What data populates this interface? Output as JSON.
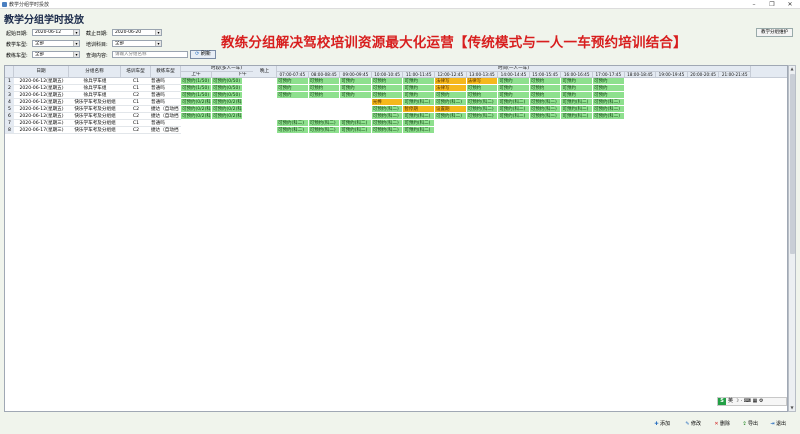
{
  "window": {
    "title": "教学分组学时投放",
    "minimize": "–",
    "restore": "❐",
    "close": "✕"
  },
  "page_title": "教学分组学时投放",
  "headline": "教练分组解决驾校培训资源最大化运营【传统模式与一人一车预约培训结合】",
  "filters": {
    "start_label": "起始日期:",
    "start_value": "2020-06-12",
    "end_label": "截止日期:",
    "end_value": "2020-06-20",
    "car_type_label": "教学车型:",
    "car_type_value": "全部",
    "subject_label": "培训科目:",
    "subject_value": "全部",
    "coach_car_label": "教练车型:",
    "coach_car_value": "全部",
    "query_label": "查询内容:",
    "query_placeholder": "请输入分组名称",
    "query_button": "刷新"
  },
  "maint_button": "教学分组维护",
  "grid": {
    "columns": {
      "date": "日期",
      "group": "分组名称",
      "car": "培训车型",
      "coach": "教练车型"
    },
    "multi_header": "时段(多人一车)",
    "morning": "上午",
    "afternoon": "下午",
    "evening": "晚上",
    "single_header": "时间(一人一车)",
    "slots": [
      "07:00-07:45",
      "08:00-08:45",
      "09:00-09:45",
      "10:00-10:45",
      "11:00-11:45",
      "12:00-12:45",
      "13:00-13:45",
      "14:00-14:45",
      "15:00-15:45",
      "16:00-16:45",
      "17:00-17:45",
      "18:00-18:45",
      "19:00-19:45",
      "20:00-20:45",
      "21:00-21:45"
    ],
    "rows": [
      {
        "n": "1",
        "date": "2020-06-12(星期五)",
        "group": "徐兵学车组",
        "car": "C1",
        "coach": "普通吗",
        "am": "可预约(1/50)",
        "pm": "可预约(0/50)"
      },
      {
        "n": "2",
        "date": "2020-06-12(星期五)",
        "group": "徐兵学车组",
        "car": "C1",
        "coach": "普通吗",
        "am": "可预约(1/50)",
        "pm": "可预约(0/50)"
      },
      {
        "n": "3",
        "date": "2020-06-12(星期五)",
        "group": "徐兵学车组",
        "car": "C2",
        "coach": "普通吗",
        "am": "可预约(1/50)",
        "pm": "可预约(0/50)"
      },
      {
        "n": "4",
        "date": "2020-06-12(星期五)",
        "group": "快乐学车考及分组组",
        "car": "C1",
        "coach": "普通吗",
        "am": "可预约(0/2)科",
        "pm": "可预约(0/2)科"
      },
      {
        "n": "5",
        "date": "2020-06-12(星期五)",
        "group": "快乐学车考及分组组",
        "car": "C2",
        "coach": "捷达（自动挡",
        "am": "可预约(0/2)科",
        "pm": "可预约(0/2)科"
      },
      {
        "n": "6",
        "date": "2020-06-12(星期五)",
        "group": "快乐学车考及分组组",
        "car": "C2",
        "coach": "捷达（自动挡",
        "am": "可预约(0/2)科",
        "pm": "可预约(0/2)科"
      },
      {
        "n": "7",
        "date": "2020-06-17(星期三)",
        "group": "快乐学车考及分组组",
        "car": "C1",
        "coach": "普通吗",
        "am": "",
        "pm": ""
      },
      {
        "n": "8",
        "date": "2020-06-17(星期三)",
        "group": "快乐学车考及分组组",
        "car": "C2",
        "coach": "捷达（自动挡",
        "am": "",
        "pm": ""
      }
    ],
    "single_cells": [
      [
        "可预约",
        "可预约",
        "可预约",
        "可预约",
        "可预约",
        "法律写",
        "法律写",
        "可预约",
        "可预约",
        "可预约",
        "可预约",
        "",
        "",
        "",
        ""
      ],
      [
        "可预约",
        "可预约",
        "可预约",
        "可预约",
        "可预约",
        "法律写",
        "可预约",
        "可预约",
        "可预约",
        "可预约",
        "可预约",
        "",
        "",
        "",
        ""
      ],
      [
        "可预约",
        "可预约",
        "可预约",
        "可预约",
        "可预约",
        "可预约",
        "可预约",
        "可预约",
        "可预约",
        "可预约",
        "可预约",
        "",
        "",
        "",
        ""
      ],
      [
        "",
        "",
        "",
        "光棒",
        "可预约(科二)",
        "可预约(科二)",
        "可预约(科二)",
        "可预约(科二)",
        "可预约(科二)",
        "可预约(科二)",
        "可预约(科二)",
        "",
        "",
        "",
        ""
      ],
      [
        "",
        "",
        "",
        "可预约(科二)",
        "暂停期",
        "设置期",
        "可预约(科二)",
        "可预约(科二)",
        "可预约(科二)",
        "可预约(科二)",
        "可预约(科二)",
        "",
        "",
        "",
        ""
      ],
      [
        "",
        "",
        "",
        "可预约(科二)",
        "可预约(科二)",
        "可预约(科二)",
        "可预约(科二)",
        "可预约(科二)",
        "可预约(科二)",
        "可预约(科二)",
        "可预约(科二)",
        "",
        "",
        "",
        ""
      ],
      [
        "可预约(科二)",
        "可预约(科二)",
        "可预约(科二)",
        "可预约(科二)",
        "可预约(科二)",
        "",
        "",
        "",
        "",
        "",
        "",
        "",
        "",
        "",
        ""
      ],
      [
        "可预约(科二)",
        "可预约(科二)",
        "可预约(科二)",
        "可预约(科二)",
        "可预约(科二)",
        "",
        "",
        "",
        "",
        "",
        "",
        "",
        "",
        "",
        ""
      ]
    ],
    "yellow_cells": [
      [
        0,
        5
      ],
      [
        0,
        6
      ],
      [
        1,
        5
      ],
      [
        3,
        3
      ],
      [
        4,
        4
      ],
      [
        4,
        5
      ]
    ]
  },
  "ime": {
    "s": "S",
    "lang": "英",
    "rest": "☽ · ⌨ ▦ ⚙"
  },
  "actions": {
    "add": "添加",
    "edit": "修改",
    "delete": "删除",
    "export": "导出",
    "exit": "退出"
  },
  "colors": {
    "available": "#8ee08e",
    "occupied": "#f5b81c",
    "headline": "#d81e1e"
  }
}
